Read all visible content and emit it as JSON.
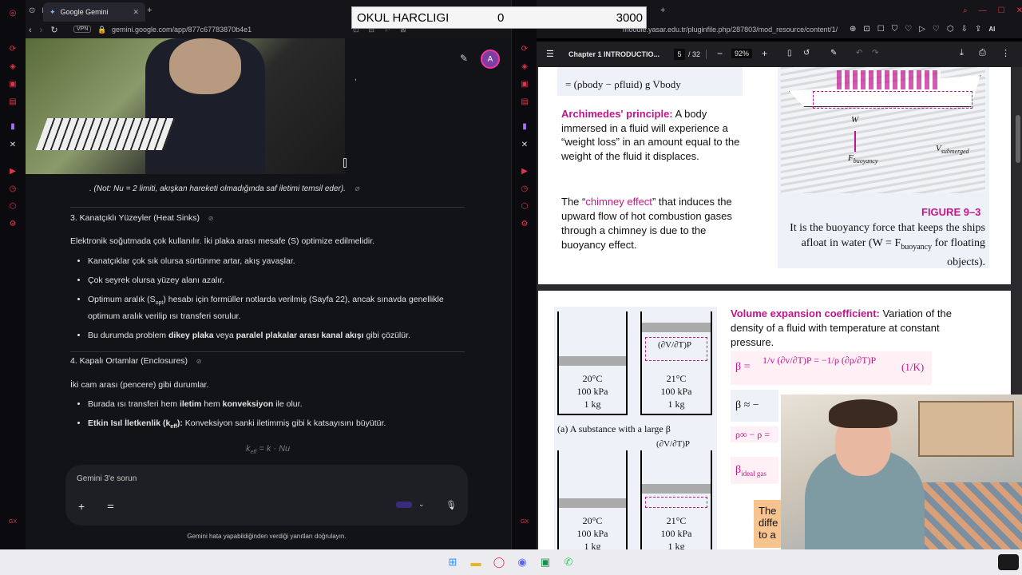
{
  "overlay": {
    "label": "OKUL HARCLIGI",
    "value1": "0",
    "value2": "3000"
  },
  "left_window": {
    "tab_title": "Google Gemini",
    "url": "gemini.google.com/app/877c67783870b4e1",
    "vpn": "VPN",
    "avatar": "A",
    "note": ". (Not: Nu = 2 limiti, akışkan hareketi olmadığında saf iletimi temsil eder).",
    "section3_title": "3. Kanatçıklı Yüzeyler (Heat Sinks)",
    "section3_intro": "Elektronik soğutmada çok kullanılır. İki plaka arası mesafe (S) optimize edilmelidir.",
    "bullets3": [
      "Kanatçıklar çok sık olursa sürtünme artar, akış yavaşlar.",
      "Çok seyrek olursa yüzey alanı azalır.",
      "Optimum aralık (S",
      "opt",
      ") hesabı için formüller notlarda verilmiş (Sayfa 22), ancak sınavda genellikle optimum aralık verilip ısı transferi sorulur.",
      "Bu durumda problem ",
      "dikey plaka",
      " veya ",
      "paralel plakalar arası kanal akışı",
      " gibi çözülür."
    ],
    "section4_title": "4. Kapalı Ortamlar (Enclosures)",
    "section4_intro": "İki cam arası (pencere) gibi durumlar.",
    "b4_1a": "Burada ısı transferi hem ",
    "b4_1b": "iletim",
    "b4_1c": " hem ",
    "b4_1d": "konveksiyon",
    "b4_1e": " ile olur.",
    "b4_2a": "Etkin Isıl İletkenlik (k",
    "b4_2sub": "eff",
    "b4_2b": "):",
    "b4_2c": " Konveksiyon sanki iletimmiş gibi k katsayısını büyütür.",
    "formula": "k",
    "formula_sub": "eff",
    "formula_rest": " = k · Nu",
    "input_placeholder": "Gemini 3'e sorun",
    "disclaimer": "Gemini hata yapabildiğinden verdiği yanıtları doğrulayın."
  },
  "right_window": {
    "url": "moodle.yasar.edu.tr/pluginfile.php/287803/mod_resource/content/1/",
    "ai_label": "AI",
    "pdf_title": "Chapter 1 INTRODUCTIO...",
    "page_current": "5",
    "page_total": "/ 32",
    "zoom": "92%",
    "top_formula": "= (ρ",
    "arch_title": "Archimedes' principle:",
    "arch_text": " A body immersed in a fluid will experience a “weight loss” in an amount equal to the weight of the fluid it displaces.",
    "chimney_pre": "The “",
    "chimney_link": "chimney effect",
    "chimney_post": "” that induces the upward flow of hot combustion gases through a chimney is due to the buoyancy effect.",
    "figure_label": "FIGURE 9–3",
    "figure_caption": "It is the buoyancy force that keeps the ships afloat in water (W = F",
    "figure_caption_sub": "buoyancy",
    "figure_caption_end": " for floating objects).",
    "ship_W": "W",
    "ship_V": "V",
    "ship_Vsub": "submerged",
    "ship_F": "F",
    "ship_Fsub": "buoyancy",
    "vec_title": "Volume expansion coefficient:",
    "vec_text": " Variation of the density of a fluid with temperature at constant pressure.",
    "beta_unit": "(1/K)",
    "beta_eq": "β = ",
    "beta_approx": "β ≈ −",
    "rho_eq": "ρ∞ − ρ =",
    "beta_ideal": "β",
    "beta_ideal_sub": "ideal gas",
    "cyl1": [
      "20°C",
      "100 kPa",
      "1 kg"
    ],
    "cyl2": [
      "21°C",
      "100 kPa",
      "1 kg"
    ],
    "cyl3": [
      "20°C",
      "100 kPa",
      "1 kg"
    ],
    "cyl4": [
      "21°C",
      "100 kPa",
      "1 kg"
    ],
    "caption_a": "(a) A substance with a large β",
    "partial": "(∂V/∂T)P",
    "note_box": "The diffe to a"
  }
}
